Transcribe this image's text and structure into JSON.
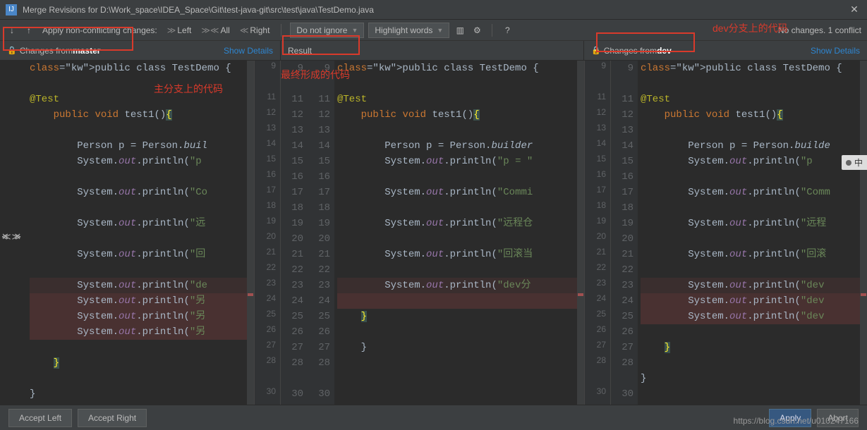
{
  "window": {
    "title": "Merge Revisions for D:\\Work_space\\IDEA_Space\\Git\\test-java-git\\src\\test\\java\\TestDemo.java"
  },
  "toolbar": {
    "apply_label": "Apply non-conflicting changes:",
    "left": "Left",
    "all": "All",
    "right": "Right",
    "ignore_dd": "Do not ignore",
    "highlight_dd": "Highlight words",
    "status": "No changes. 1 conflict"
  },
  "headers": {
    "left_prefix": "Changes from ",
    "left_branch": "master",
    "result": "Result",
    "right_prefix": "Changes from ",
    "right_branch": "dev",
    "show_details": "Show Details"
  },
  "annotations": {
    "left": "主分支上的代码",
    "center": "最终形成的代码",
    "right": "dev分支上的代码"
  },
  "footer": {
    "accept_left": "Accept Left",
    "accept_right": "Accept Right",
    "apply": "Apply",
    "abort": "Abort"
  },
  "watermark": "https://blog.csdn.net/u010247166",
  "ime": "中",
  "gutter": {
    "left": [
      "",
      "",
      "",
      "",
      "",
      "",
      "",
      "",
      "",
      "",
      "",
      "",
      "",
      "",
      "",
      "",
      "",
      "",
      "",
      "",
      "",
      ""
    ],
    "mid_left": [
      "9",
      "",
      "11",
      "12",
      "13",
      "14",
      "15",
      "16",
      "17",
      "18",
      "19",
      "20",
      "21",
      "22",
      "23",
      "24",
      "25",
      "26",
      "27",
      "28",
      "",
      "30"
    ],
    "mid_right": [
      "9",
      "",
      "11",
      "12",
      "13",
      "14",
      "15",
      "16",
      "17",
      "18",
      "19",
      "20",
      "21",
      "22",
      "23",
      "24",
      "25",
      "26",
      "27",
      "28",
      "",
      "30"
    ],
    "right": [
      "9",
      "",
      "11",
      "12",
      "13",
      "14",
      "15",
      "16",
      "17",
      "18",
      "19",
      "20",
      "21",
      "22",
      "23",
      "24",
      "25",
      "26",
      "27",
      "28",
      "",
      "30"
    ]
  },
  "code_left": [
    {
      "t": "public class TestDemo {",
      "kw": [
        "public",
        "class"
      ]
    },
    {
      "t": ""
    },
    {
      "t": "    @Test",
      "ann": true
    },
    {
      "t": "    public void test1(){",
      "kw": [
        "public",
        "void"
      ],
      "hl_end": true
    },
    {
      "t": ""
    },
    {
      "t": "        Person p = Person.buil",
      "ital": "buil"
    },
    {
      "t": "        System.out.println(\"p",
      "field": "out",
      "str": "\"p"
    },
    {
      "t": ""
    },
    {
      "t": "        System.out.println(\"Co",
      "field": "out",
      "str": "\"Co"
    },
    {
      "t": ""
    },
    {
      "t": "        System.out.println(\"远",
      "field": "out",
      "str": "\"远"
    },
    {
      "t": ""
    },
    {
      "t": "        System.out.println(\"回",
      "field": "out",
      "str": "\"回"
    },
    {
      "t": ""
    },
    {
      "t": "        System.out.println(\"de",
      "field": "out",
      "str": "\"de",
      "cls": "edge"
    },
    {
      "t": "        System.out.println(\"另",
      "field": "out",
      "str": "\"另",
      "cls": "conflict"
    },
    {
      "t": "        System.out.println(\"另",
      "field": "out",
      "str": "\"另",
      "cls": "conflict"
    },
    {
      "t": "        System.out.println(\"另",
      "field": "out",
      "str": "\"另",
      "cls": "conflict"
    },
    {
      "t": ""
    },
    {
      "t": "    }",
      "hl": true
    },
    {
      "t": ""
    },
    {
      "t": "}"
    }
  ],
  "code_mid": [
    {
      "t": "public class TestDemo {",
      "kw": [
        "public",
        "class"
      ]
    },
    {
      "t": ""
    },
    {
      "t": "    @Test",
      "ann": true
    },
    {
      "t": "    public void test1(){",
      "kw": [
        "public",
        "void"
      ],
      "hl_end": true
    },
    {
      "t": ""
    },
    {
      "t": "        Person p = Person.builder",
      "ital": "builder"
    },
    {
      "t": "        System.out.println(\"p = \"",
      "field": "out",
      "str": "\"p = \""
    },
    {
      "t": ""
    },
    {
      "t": "        System.out.println(\"Commi",
      "field": "out",
      "str": "\"Commi"
    },
    {
      "t": ""
    },
    {
      "t": "        System.out.println(\"远程仓",
      "field": "out",
      "str": "\"远程仓"
    },
    {
      "t": ""
    },
    {
      "t": "        System.out.println(\"回滚当",
      "field": "out",
      "str": "\"回滚当"
    },
    {
      "t": ""
    },
    {
      "t": "        System.out.println(\"dev分",
      "field": "out",
      "str": "\"dev分",
      "cls": "edge"
    },
    {
      "t": "",
      "cls": "conflict"
    },
    {
      "t": "    }",
      "hl": true
    },
    {
      "t": ""
    },
    {
      "t": "    }"
    },
    {
      "t": ""
    },
    {
      "t": ""
    },
    {
      "t": ""
    }
  ],
  "code_right": [
    {
      "t": "public class TestDemo {",
      "kw": [
        "public",
        "class"
      ]
    },
    {
      "t": ""
    },
    {
      "t": "    @Test",
      "ann": true
    },
    {
      "t": "    public void test1(){",
      "kw": [
        "public",
        "void"
      ],
      "hl_end": true
    },
    {
      "t": ""
    },
    {
      "t": "        Person p = Person.builde",
      "ital": "builde"
    },
    {
      "t": "        System.out.println(\"p",
      "field": "out",
      "str": "\"p"
    },
    {
      "t": ""
    },
    {
      "t": "        System.out.println(\"Comm",
      "field": "out",
      "str": "\"Comm"
    },
    {
      "t": ""
    },
    {
      "t": "        System.out.println(\"远程",
      "field": "out",
      "str": "\"远程"
    },
    {
      "t": ""
    },
    {
      "t": "        System.out.println(\"回滚",
      "field": "out",
      "str": "\"回滚"
    },
    {
      "t": ""
    },
    {
      "t": "        System.out.println(\"dev",
      "field": "out",
      "str": "\"dev",
      "cls": "edge"
    },
    {
      "t": "        System.out.println(\"dev",
      "field": "out",
      "str": "\"dev",
      "cls": "conflict"
    },
    {
      "t": "        System.out.println(\"dev",
      "field": "out",
      "str": "\"dev",
      "cls": "conflict"
    },
    {
      "t": ""
    },
    {
      "t": "    }",
      "hl": true
    },
    {
      "t": ""
    },
    {
      "t": "}"
    },
    {
      "t": ""
    }
  ],
  "merge_ops": {
    "left": "✕ ≫",
    "right": "≪ ✕"
  }
}
